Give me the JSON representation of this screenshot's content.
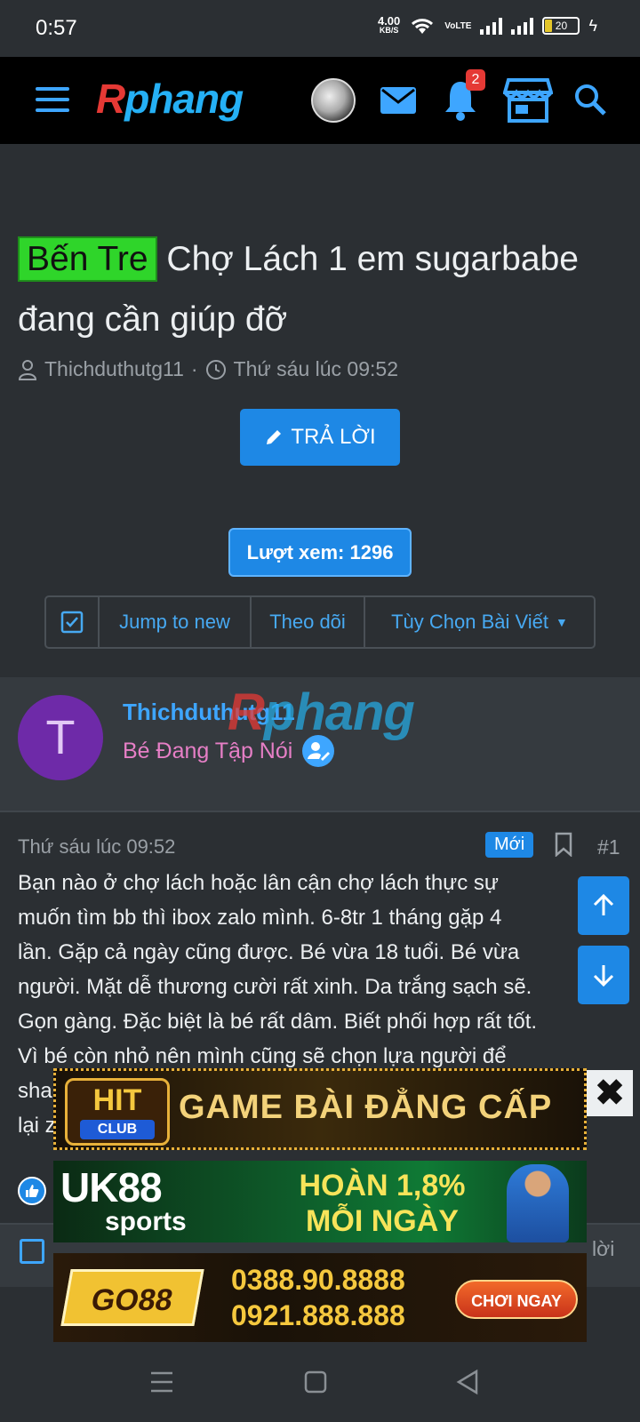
{
  "status_bar": {
    "time": "0:57",
    "net_speed": "4.00",
    "net_unit": "KB/S",
    "network_label": "VoLTE",
    "battery": "20"
  },
  "header": {
    "logo_first": "R",
    "logo_rest": "phang",
    "notification_count": "2",
    "icons": [
      "menu-icon",
      "avatar",
      "mail-icon",
      "bell-icon",
      "store-icon",
      "search-icon"
    ]
  },
  "thread": {
    "prefix": "Bến Tre",
    "title": "Chợ Lách 1 em sugarbabe đang cần giúp đỡ",
    "author": "Thichduthutg11",
    "separator": "·",
    "date": "Thứ sáu lúc 09:52",
    "reply_label": "TRẢ LỜI",
    "views_label": "Lượt xem: 1296",
    "toolbar": {
      "jump": "Jump to new",
      "watch": "Theo dõi",
      "options": "Tùy Chọn Bài Viết"
    }
  },
  "post": {
    "avatar_letter": "T",
    "username": "Thichduthutg11",
    "user_title": "Bé Đang Tập Nói",
    "watermark_first": "R",
    "watermark_rest": "phang",
    "date": "Thứ sáu lúc 09:52",
    "new_badge": "Mới",
    "number": "#1",
    "text_lines": [
      "Bạn nào ở chợ lách hoặc lân cận chợ lách thực sự",
      "muốn tìm bb thì ibox zalo mình. 6-8tr 1 tháng gặp 4",
      "lần. Gặp cả ngày cũng được. Bé vừa 18 tuổi. Bé vừa",
      "người. Mặt dễ thương cười rất xinh. Da trắng sạch sẽ.",
      "Gọn gàng. Đặc biệt là bé rất dâm. Biết phối hợp rất tốt.",
      "Vì bé còn nhỏ nên mình cũng sẽ chọn lựa người để",
      "sha",
      "lại z"
    ],
    "footer_reply": "lời"
  },
  "ads": {
    "close": "✖",
    "hit_logo": "HIT",
    "hit_club": "CLUB",
    "hit_slogan": "GAME BÀI ĐẲNG CẤP",
    "uk88_big": "UK88",
    "uk88_small": "sports",
    "uk88_promo_1": "HOÀN 1,8%",
    "uk88_promo_2": "MỖI NGÀY",
    "go88_logo": "GO88",
    "go88_phone_1": "0388.90.8888",
    "go88_phone_2": "0921.888.888",
    "go88_play": "CHƠI NGAY"
  },
  "colors": {
    "accent": "#1e88e5",
    "link": "#3ea6ff",
    "prefix_bg": "#2fd52a",
    "user_title": "#e67fc6",
    "avatar_bg": "#6e2aa8",
    "badge": "#e53935"
  }
}
